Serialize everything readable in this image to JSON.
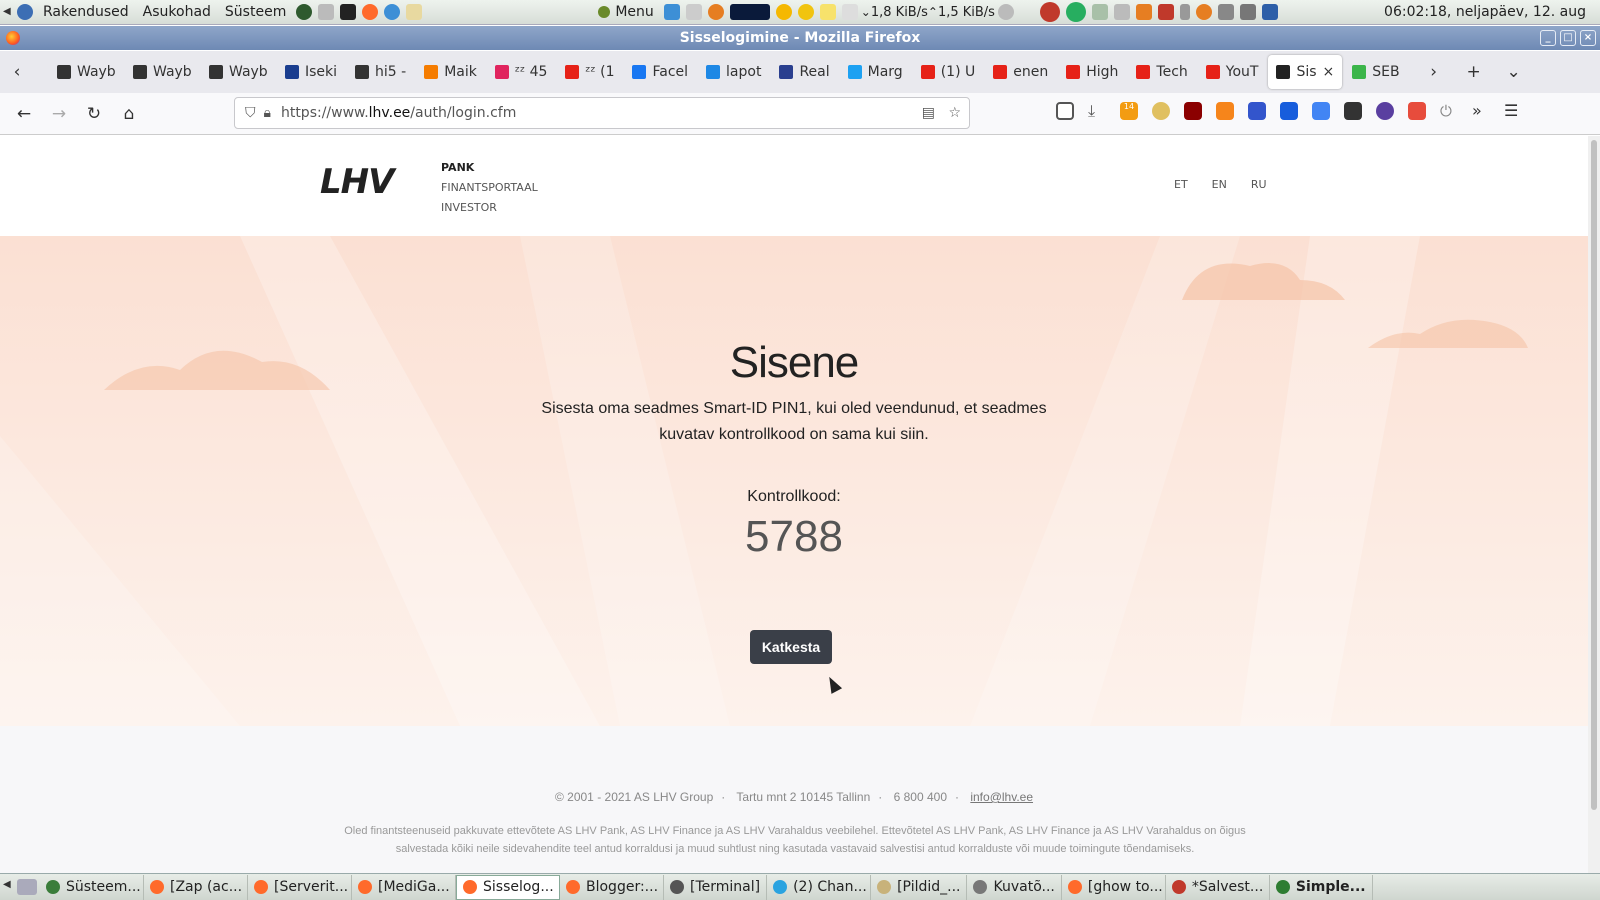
{
  "system_bar": {
    "menus": [
      "Rakendused",
      "Asukohad",
      "Süsteem"
    ],
    "menu_label": "Menu",
    "net_down": "1,8 KiB/s",
    "net_up": "1,5 KiB/s",
    "clock": "06:02:18, neljapäev, 12. aug"
  },
  "window": {
    "title": "Sisselogimine - Mozilla Firefox"
  },
  "tabs": [
    {
      "label": "Wayb",
      "color": "#333333"
    },
    {
      "label": "Wayb",
      "color": "#333333"
    },
    {
      "label": "Wayb",
      "color": "#333333"
    },
    {
      "label": "Iseki",
      "color": "#1a3d8f"
    },
    {
      "label": "hi5 -",
      "color": "#333333"
    },
    {
      "label": "Maik",
      "color": "#f57c00"
    },
    {
      "label": "ᶻᶻ 45",
      "color": "#e0245e"
    },
    {
      "label": "ᶻᶻ (1",
      "color": "#e62117"
    },
    {
      "label": "Facel",
      "color": "#1877f2"
    },
    {
      "label": "lapot",
      "color": "#1e88e5"
    },
    {
      "label": "Real",
      "color": "#2a3f8f"
    },
    {
      "label": "Marg",
      "color": "#1da1f2"
    },
    {
      "label": "(1) U",
      "color": "#e62117"
    },
    {
      "label": "enen",
      "color": "#e62117"
    },
    {
      "label": "High",
      "color": "#e62117"
    },
    {
      "label": "Tech",
      "color": "#e62117"
    },
    {
      "label": "YouT",
      "color": "#e62117"
    },
    {
      "label": "Sis",
      "color": "#222222",
      "active": true
    },
    {
      "label": "SEB",
      "color": "#3bb54a"
    }
  ],
  "nav": {
    "url_prefix": "https://www.",
    "url_host": "lhv.ee",
    "url_path": "/auth/login.cfm",
    "badge": "14"
  },
  "lhv": {
    "logo": "LHV",
    "products": [
      "PANK",
      "FINANTSPORTAAL",
      "INVESTOR"
    ],
    "langs": [
      "ET",
      "EN",
      "RU"
    ],
    "heading": "Sisene",
    "description": "Sisesta oma seadmes Smart-ID PIN1, kui oled veendunud, et seadmes kuvatav kontrollkood on sama kui siin.",
    "control_label": "Kontrollkood:",
    "control_code": "5788",
    "cancel": "Katkesta",
    "footer": {
      "copyright": "© 2001 - 2021 AS LHV Group",
      "address": "Tartu mnt 2 10145 Tallinn",
      "phone": "6 800 400",
      "email": "info@lhv.ee",
      "disclaimer": "Oled finantsteenuseid pakkuvate ettevõtete AS LHV Pank, AS LHV Finance ja AS LHV Varahaldus veebilehel. Ettevõtetel AS LHV Pank, AS LHV Finance ja AS LHV Varahaldus on õigus salvestada kõiki neile sidevahendite teel antud korraldusi ja muud suhtlust ning kasutada vastavaid salvestisi antud korralduste või muude toimingute tõendamiseks."
    }
  },
  "taskbar": [
    {
      "label": "Süsteem...",
      "color": "#3a7d3a"
    },
    {
      "label": "[Zap (ac...",
      "color": "#ff6a2b"
    },
    {
      "label": "[Serverit...",
      "color": "#ff6a2b"
    },
    {
      "label": "[MediGa...",
      "color": "#ff6a2b"
    },
    {
      "label": "Sisselog...",
      "color": "#ff6a2b",
      "active": true
    },
    {
      "label": "Blogger:...",
      "color": "#ff6a2b"
    },
    {
      "label": "[Terminal]",
      "color": "#555555"
    },
    {
      "label": "(2) Chan...",
      "color": "#2aa3e0"
    },
    {
      "label": "[Pildid_...",
      "color": "#c8b27a"
    },
    {
      "label": "Kuvatõ...",
      "color": "#777777"
    },
    {
      "label": "[ghow to...",
      "color": "#ff6a2b"
    },
    {
      "label": "*Salvest...",
      "color": "#c0392b"
    },
    {
      "label": "Simple...",
      "color": "#2e7d32",
      "bold": true
    }
  ]
}
